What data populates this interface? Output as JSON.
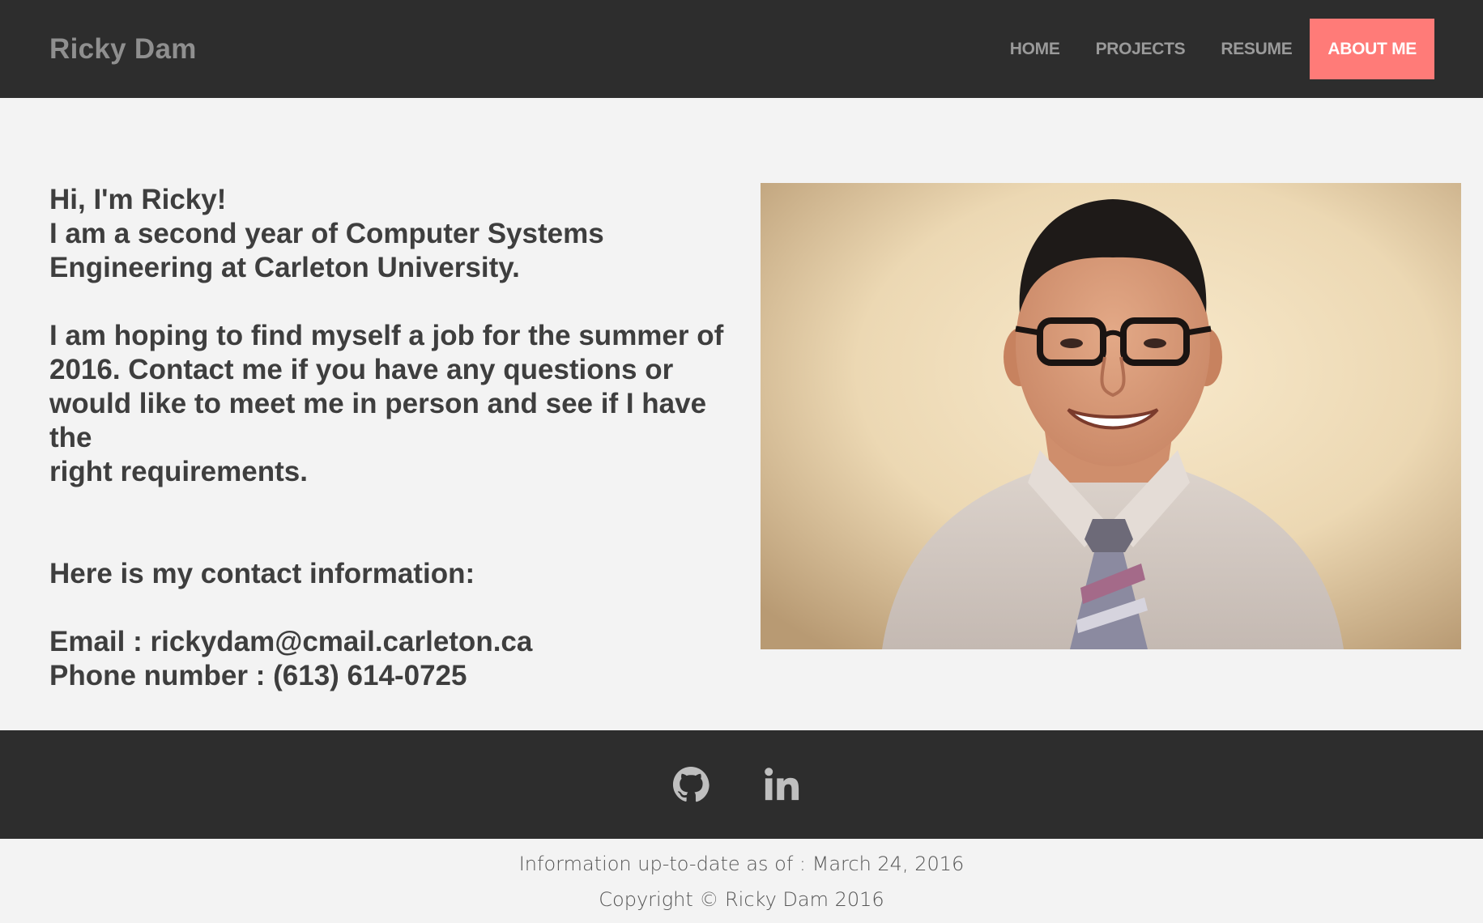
{
  "header": {
    "brand": "Ricky Dam",
    "nav": [
      {
        "label": "HOME"
      },
      {
        "label": "PROJECTS"
      },
      {
        "label": "RESUME"
      },
      {
        "label": "ABOUT ME",
        "active": true
      }
    ]
  },
  "intro": {
    "greeting": "Hi, I'm Ricky!",
    "line1": "I am a second year of Computer Systems",
    "line2": "Engineering at Carleton University.",
    "hope1": "I am hoping to find myself a job for the summer of",
    "hope2": "2016. Contact me if you have any questions or",
    "hope3": "would like to meet me in person and see if I have the",
    "hope4": "right requirements.",
    "contact_heading": "Here is my contact information:",
    "email": "Email : rickydam@cmail.carleton.ca",
    "phone": "Phone number : (613) 614-0725"
  },
  "colors": {
    "header_bg": "#2d2d2d",
    "page_bg": "#f3f3f3",
    "accent": "#ff7b78",
    "nav_text": "#9a9a9a"
  },
  "footer": {
    "icons": [
      "github-icon",
      "linkedin-icon"
    ],
    "updated": "Information up-to-date as of : March 24, 2016",
    "copyright": "Copyright © Ricky Dam 2016"
  }
}
